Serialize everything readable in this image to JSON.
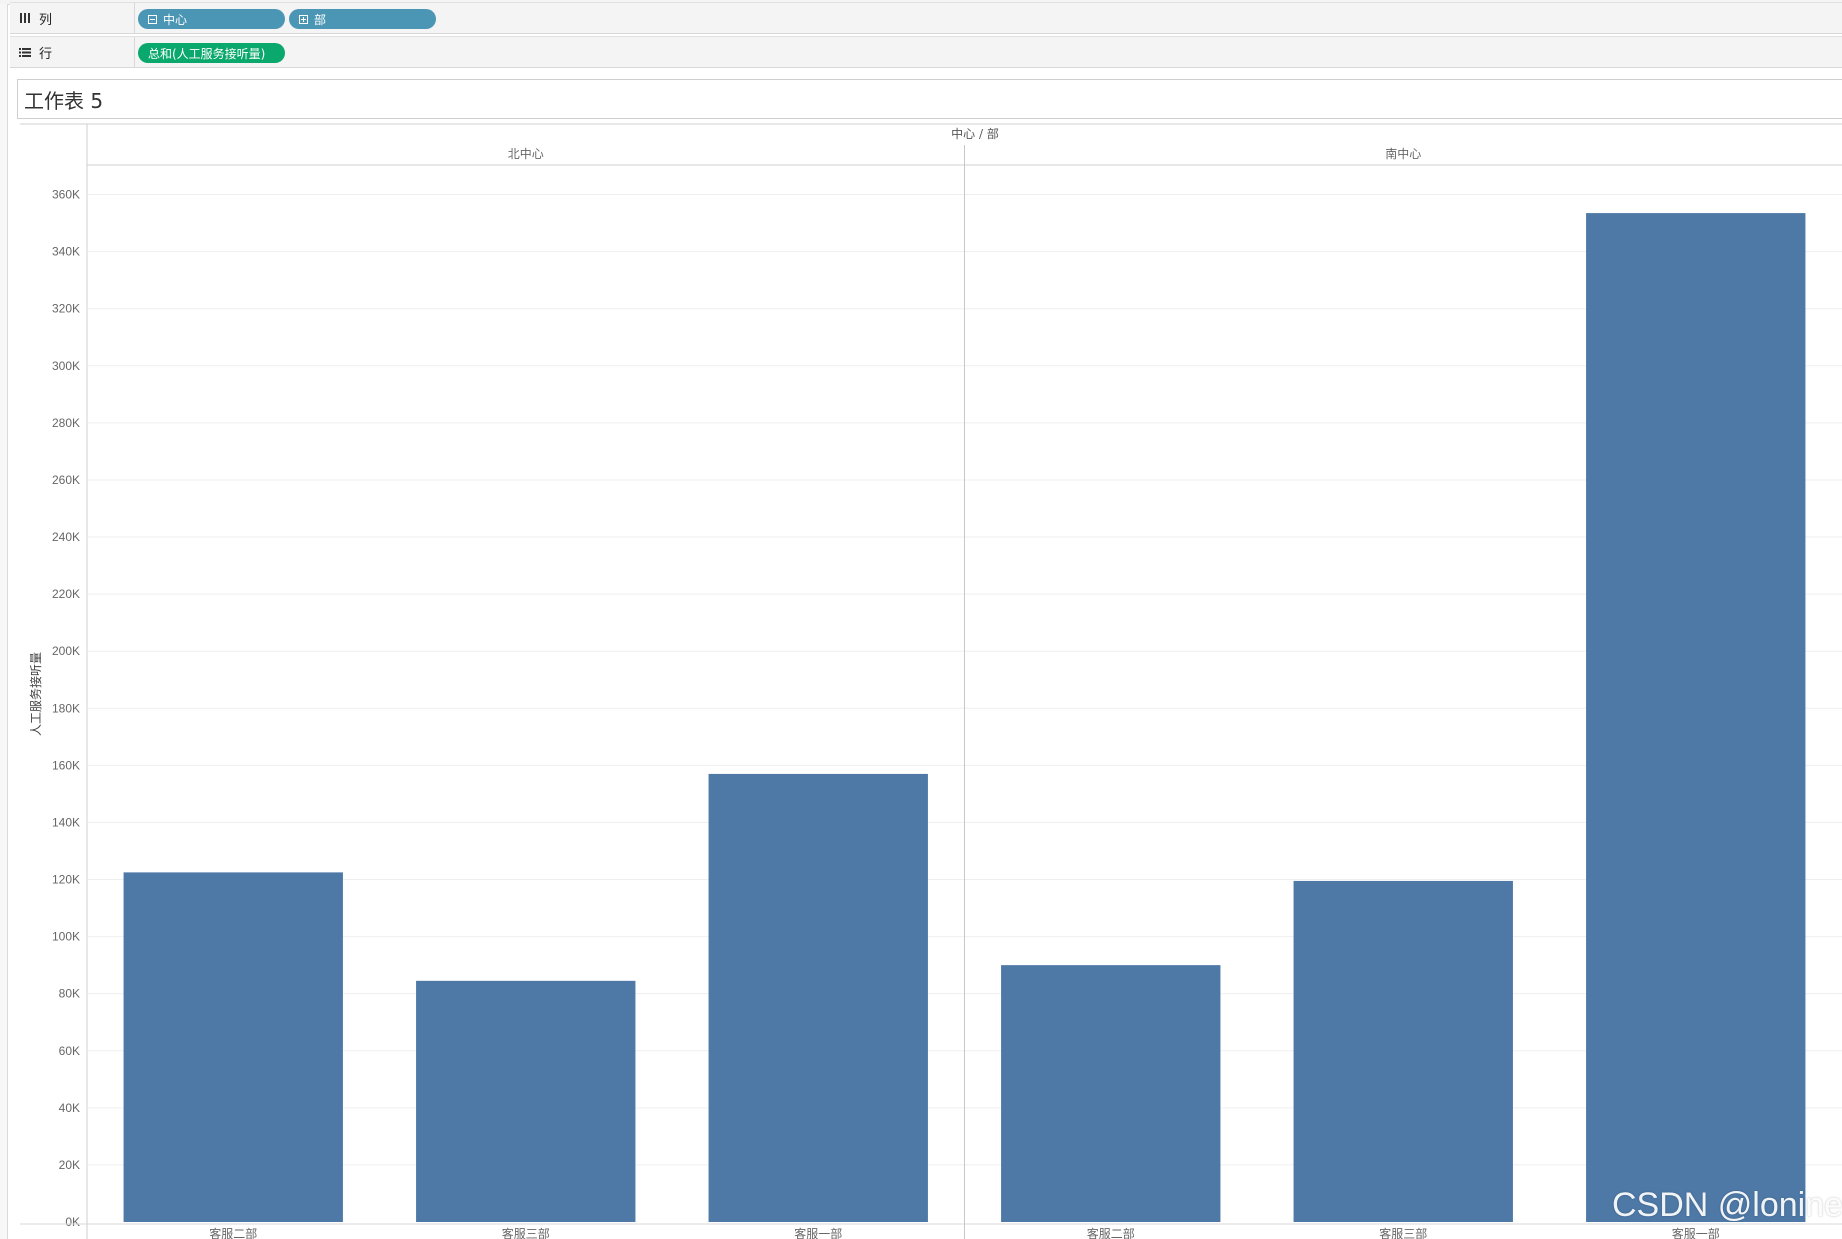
{
  "shelves": {
    "columns": {
      "label": "列",
      "pills": [
        {
          "text": "中心"
        },
        {
          "text": "部"
        }
      ]
    },
    "rows": {
      "label": "行",
      "pills": [
        {
          "text": "总和(人工服务接听量)"
        }
      ]
    }
  },
  "sheet": {
    "title": "工作表 5"
  },
  "chart_data": {
    "type": "bar",
    "header": "中心 / 部",
    "ylabel": "人工服务接听量",
    "ylim": [
      0,
      370000
    ],
    "yticks": [
      0,
      20000,
      40000,
      60000,
      80000,
      100000,
      120000,
      140000,
      160000,
      180000,
      200000,
      220000,
      240000,
      260000,
      280000,
      300000,
      320000,
      340000,
      360000
    ],
    "ytick_labels": [
      "0K",
      "20K",
      "40K",
      "60K",
      "80K",
      "100K",
      "120K",
      "140K",
      "160K",
      "180K",
      "200K",
      "220K",
      "240K",
      "260K",
      "280K",
      "300K",
      "320K",
      "340K",
      "360K"
    ],
    "grid": true,
    "bar_color": "#4e79a7",
    "panels": [
      {
        "name": "北中心",
        "categories": [
          "客服二部",
          "客服三部",
          "客服一部"
        ],
        "values": [
          122500,
          84500,
          157000
        ]
      },
      {
        "name": "南中心",
        "categories": [
          "客服二部",
          "客服三部",
          "客服一部"
        ],
        "values": [
          90000,
          119500,
          353500
        ]
      }
    ]
  },
  "watermark": "CSDN @lonine"
}
